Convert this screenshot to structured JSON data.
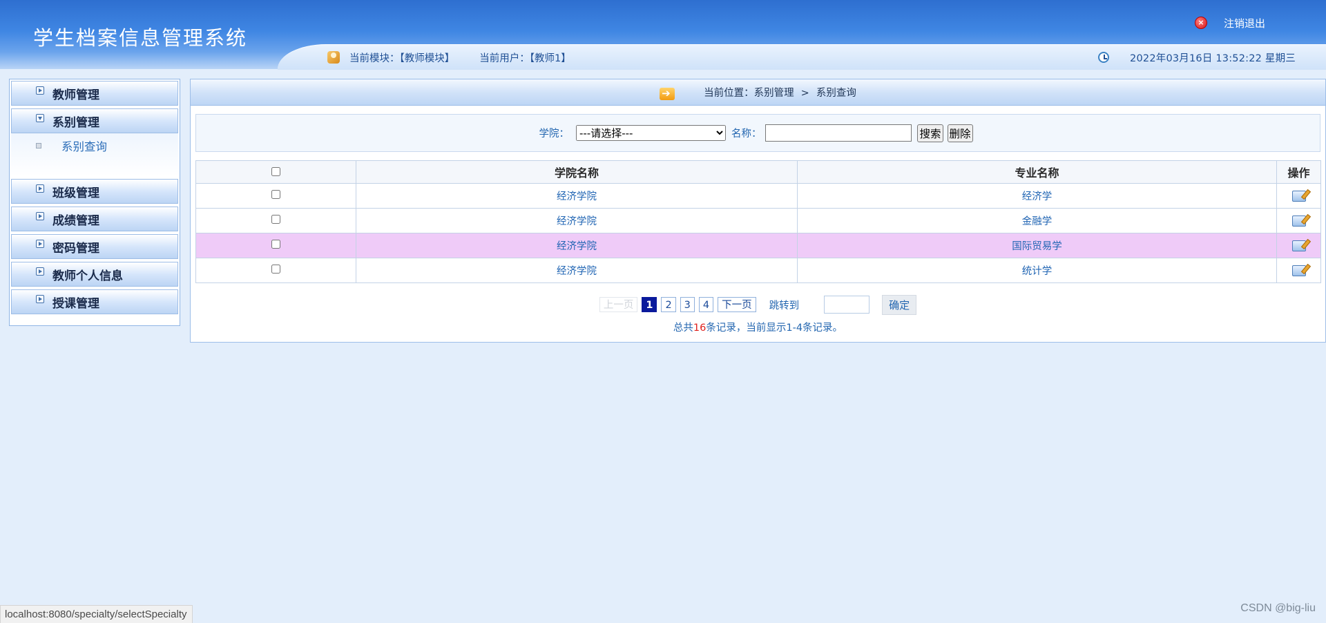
{
  "header": {
    "title": "学生档案信息管理系统",
    "logout_label": "注销退出",
    "logout_icon": "close-icon",
    "module_label": "当前模块：【教师模块】",
    "user_label": "当前用户：【教师1】",
    "datetime": "2022年03月16日 13:52:22 星期三"
  },
  "sidebar": {
    "items": [
      {
        "label": "教师管理",
        "expanded": false
      },
      {
        "label": "系别管理",
        "expanded": true,
        "children": [
          "系别查询"
        ]
      },
      {
        "label": "班级管理",
        "expanded": false
      },
      {
        "label": "成绩管理",
        "expanded": false
      },
      {
        "label": "密码管理",
        "expanded": false
      },
      {
        "label": "教师个人信息",
        "expanded": false
      },
      {
        "label": "授课管理",
        "expanded": false
      }
    ]
  },
  "breadcrumb": {
    "prefix": "当前位置：",
    "parts": [
      "系别管理",
      "系别查询"
    ],
    "separator": ">"
  },
  "search": {
    "college_label": "学院：",
    "college_selected": "---请选择---",
    "name_label": "名称：",
    "name_value": "",
    "search_button": "搜索",
    "delete_button": "删除"
  },
  "table": {
    "columns": [
      "",
      "学院名称",
      "专业名称",
      "操作"
    ],
    "rows": [
      {
        "college": "经济学院",
        "major": "经济学",
        "highlighted": false
      },
      {
        "college": "经济学院",
        "major": "金融学",
        "highlighted": false
      },
      {
        "college": "经济学院",
        "major": "国际贸易学",
        "highlighted": true
      },
      {
        "college": "经济学院",
        "major": "统计学",
        "highlighted": false
      }
    ]
  },
  "pager": {
    "prev": "上一页",
    "pages": [
      "1",
      "2",
      "3",
      "4"
    ],
    "current": "1",
    "next": "下一页",
    "jump_label": "跳转到",
    "jump_value": "",
    "confirm": "确定",
    "summary_prefix": "总共",
    "summary_total": "16",
    "summary_suffix": "条记录，当前显示1-4条记录。"
  },
  "statusbar": {
    "url": "localhost:8080/specialty/selectSpecialty"
  },
  "watermark": "CSDN @big-liu"
}
